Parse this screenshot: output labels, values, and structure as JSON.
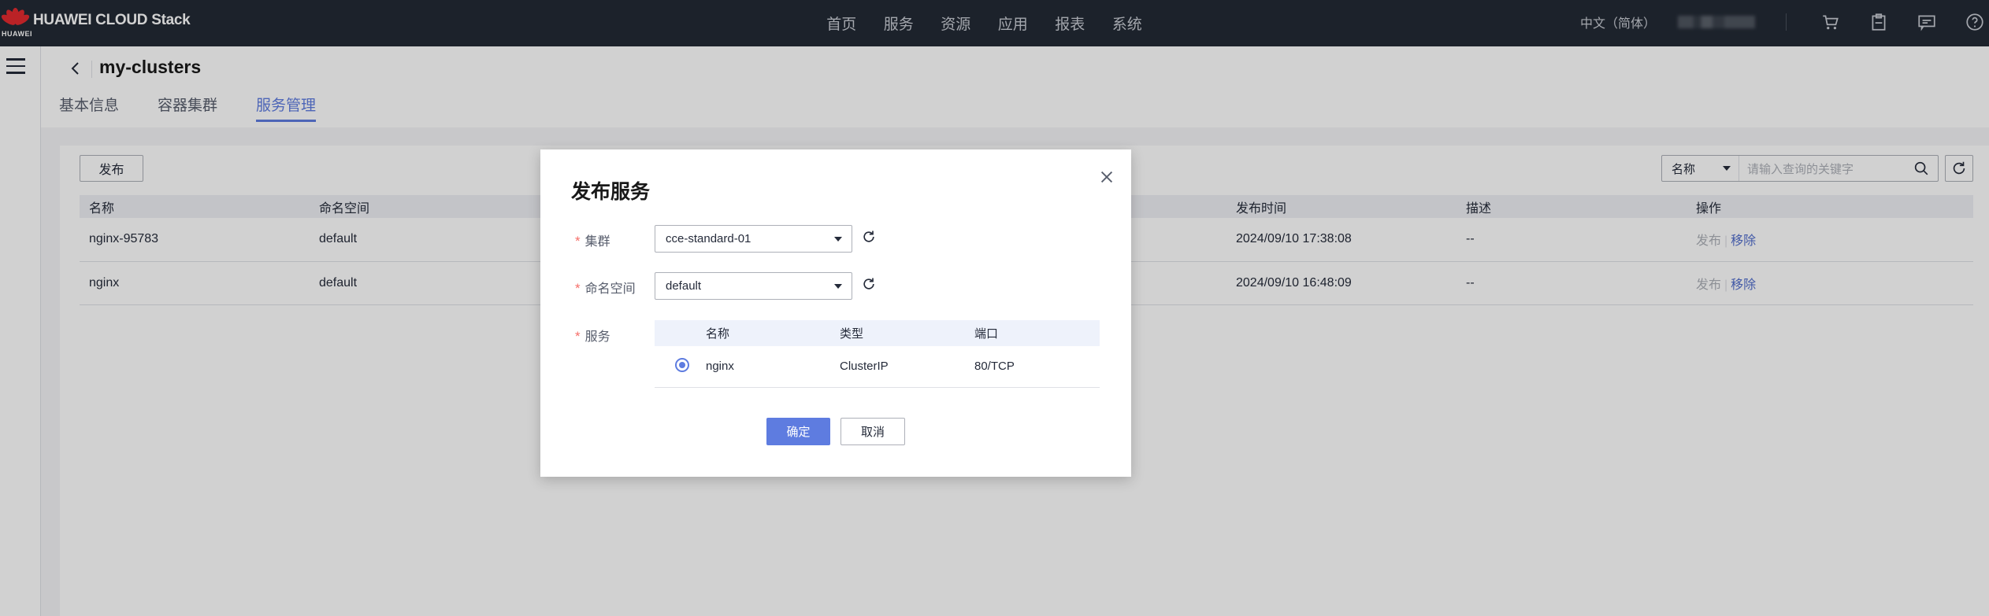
{
  "brand": {
    "name": "HUAWEI CLOUD Stack",
    "sub": "HUAWEI"
  },
  "nav": {
    "items": [
      "首页",
      "服务",
      "资源",
      "应用",
      "报表",
      "系统"
    ],
    "lang": "中文（简体）",
    "icons": [
      "cart-icon",
      "clipboard-icon",
      "message-icon",
      "help-icon"
    ]
  },
  "page": {
    "title": "my-clusters",
    "tabs": [
      {
        "label": "基本信息",
        "active": false
      },
      {
        "label": "容器集群",
        "active": false
      },
      {
        "label": "服务管理",
        "active": true
      }
    ]
  },
  "toolbar": {
    "publish_label": "发布",
    "search_field": "名称",
    "search_placeholder": "请输入查询的关键字"
  },
  "table": {
    "headers": {
      "name": "名称",
      "namespace": "命名空间",
      "time": "发布时间",
      "desc": "描述",
      "ops": "操作"
    },
    "rows": [
      {
        "name": "nginx-95783",
        "namespace": "default",
        "time": "2024/09/10 17:38:08",
        "desc": "--",
        "op1": "发布",
        "op2": "移除"
      },
      {
        "name": "nginx",
        "namespace": "default",
        "time": "2024/09/10 16:48:09",
        "desc": "--",
        "op1": "发布",
        "op2": "移除"
      }
    ]
  },
  "modal": {
    "title": "发布服务",
    "cluster_label": "集群",
    "cluster_value": "cce-standard-01",
    "namespace_label": "命名空间",
    "namespace_value": "default",
    "service_label": "服务",
    "service_table": {
      "headers": {
        "name": "名称",
        "type": "类型",
        "port": "端口"
      },
      "rows": [
        {
          "selected": true,
          "name": "nginx",
          "type": "ClusterIP",
          "port": "80/TCP"
        }
      ]
    },
    "confirm_label": "确定",
    "cancel_label": "取消"
  },
  "colors": {
    "primary": "#5e7ce0",
    "topbar": "#232a35",
    "required": "#f66f6a",
    "link": "#526ecc"
  }
}
